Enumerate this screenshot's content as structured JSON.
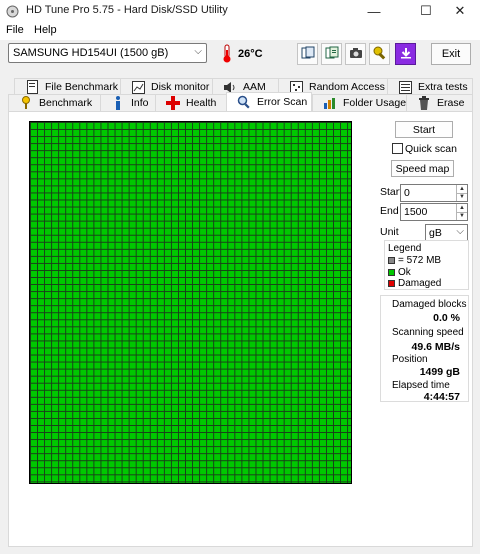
{
  "window": {
    "title": "HD Tune Pro 5.75 - Hard Disk/SSD Utility",
    "minimize_glyph": "—",
    "maximize_glyph": "☐",
    "close_glyph": "✕"
  },
  "menu": {
    "file": "File",
    "help": "Help"
  },
  "toolbar": {
    "drive": "SAMSUNG HD154UI (1500 gB)",
    "temperature": "26°C",
    "buttons": [
      "copy-info-icon",
      "copy-text-icon",
      "screenshot-icon",
      "options-icon",
      "save-icon"
    ],
    "exit": "Exit"
  },
  "tabs_row1": [
    "File Benchmark",
    "Disk monitor",
    "AAM",
    "Random Access",
    "Extra tests"
  ],
  "tabs_row2": [
    "Benchmark",
    "Info",
    "Health",
    "Error Scan",
    "Folder Usage",
    "Erase"
  ],
  "active_tab": "Error Scan",
  "scan": {
    "start_button": "Start",
    "quick_scan": "Quick scan",
    "speed_map": "Speed map",
    "start_label": "Start",
    "start_value": "0",
    "end_label": "End",
    "end_value": "1500",
    "unit_label": "Unit",
    "unit_value": "gB"
  },
  "legend": {
    "title": "Legend",
    "block": "= 572 MB",
    "ok": "Ok",
    "damaged": "Damaged"
  },
  "stats": {
    "damaged_blocks_label": "Damaged blocks",
    "damaged_blocks_value": "0.0 %",
    "scanning_speed_label": "Scanning speed",
    "scanning_speed_value": "49.6 MB/s",
    "position_label": "Position",
    "position_value": "1499 gB",
    "elapsed_label": "Elapsed time",
    "elapsed_value": "4:44:57"
  },
  "colors": {
    "ok": "#00c800",
    "damaged": "#e00000",
    "block": "#888888"
  }
}
